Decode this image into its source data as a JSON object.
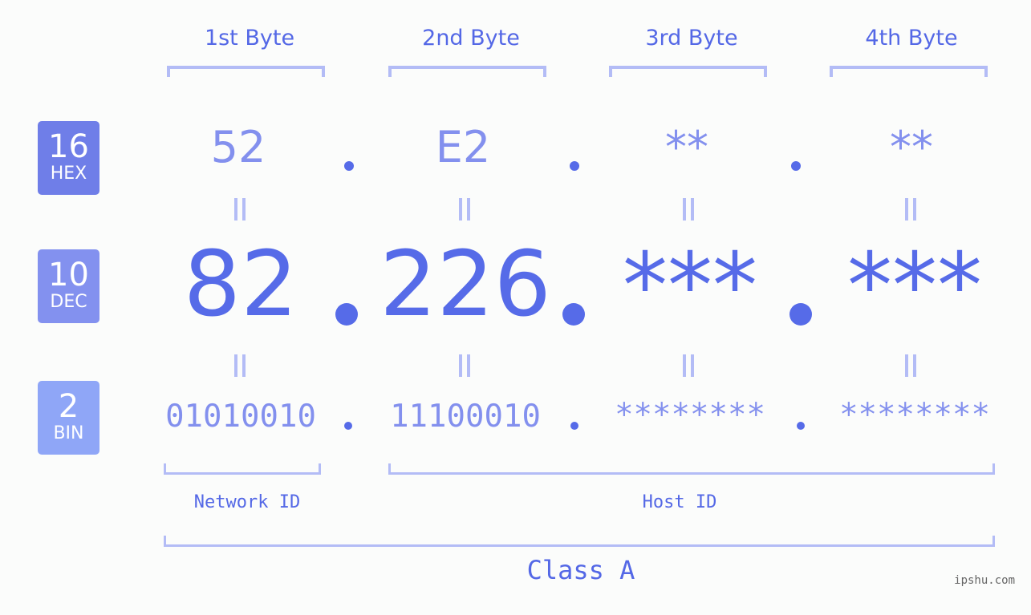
{
  "colors": {
    "background": "#fbfcfb",
    "accent": "#566be8",
    "hex_badge": "#6f7ee8",
    "dec_badge": "#8391ef",
    "bin_badge": "#8fa6f7",
    "bracket": "#b3bcf6"
  },
  "badges": [
    {
      "number": "16",
      "label": "HEX"
    },
    {
      "number": "10",
      "label": "DEC"
    },
    {
      "number": "2",
      "label": "BIN"
    }
  ],
  "byte_headers": [
    "1st Byte",
    "2nd Byte",
    "3rd Byte",
    "4th Byte"
  ],
  "hex_values": [
    "52",
    "E2",
    "**",
    "**"
  ],
  "dec_values": [
    "82",
    "226",
    "***",
    "***"
  ],
  "bin_values": [
    "01010010",
    "11100010",
    "********",
    "********"
  ],
  "separator": ".",
  "equals_icon": "vertical-equals-icon",
  "segments": {
    "network_id": "Network ID",
    "host_id": "Host ID",
    "class": "Class A"
  },
  "watermark": "ipshu.com"
}
